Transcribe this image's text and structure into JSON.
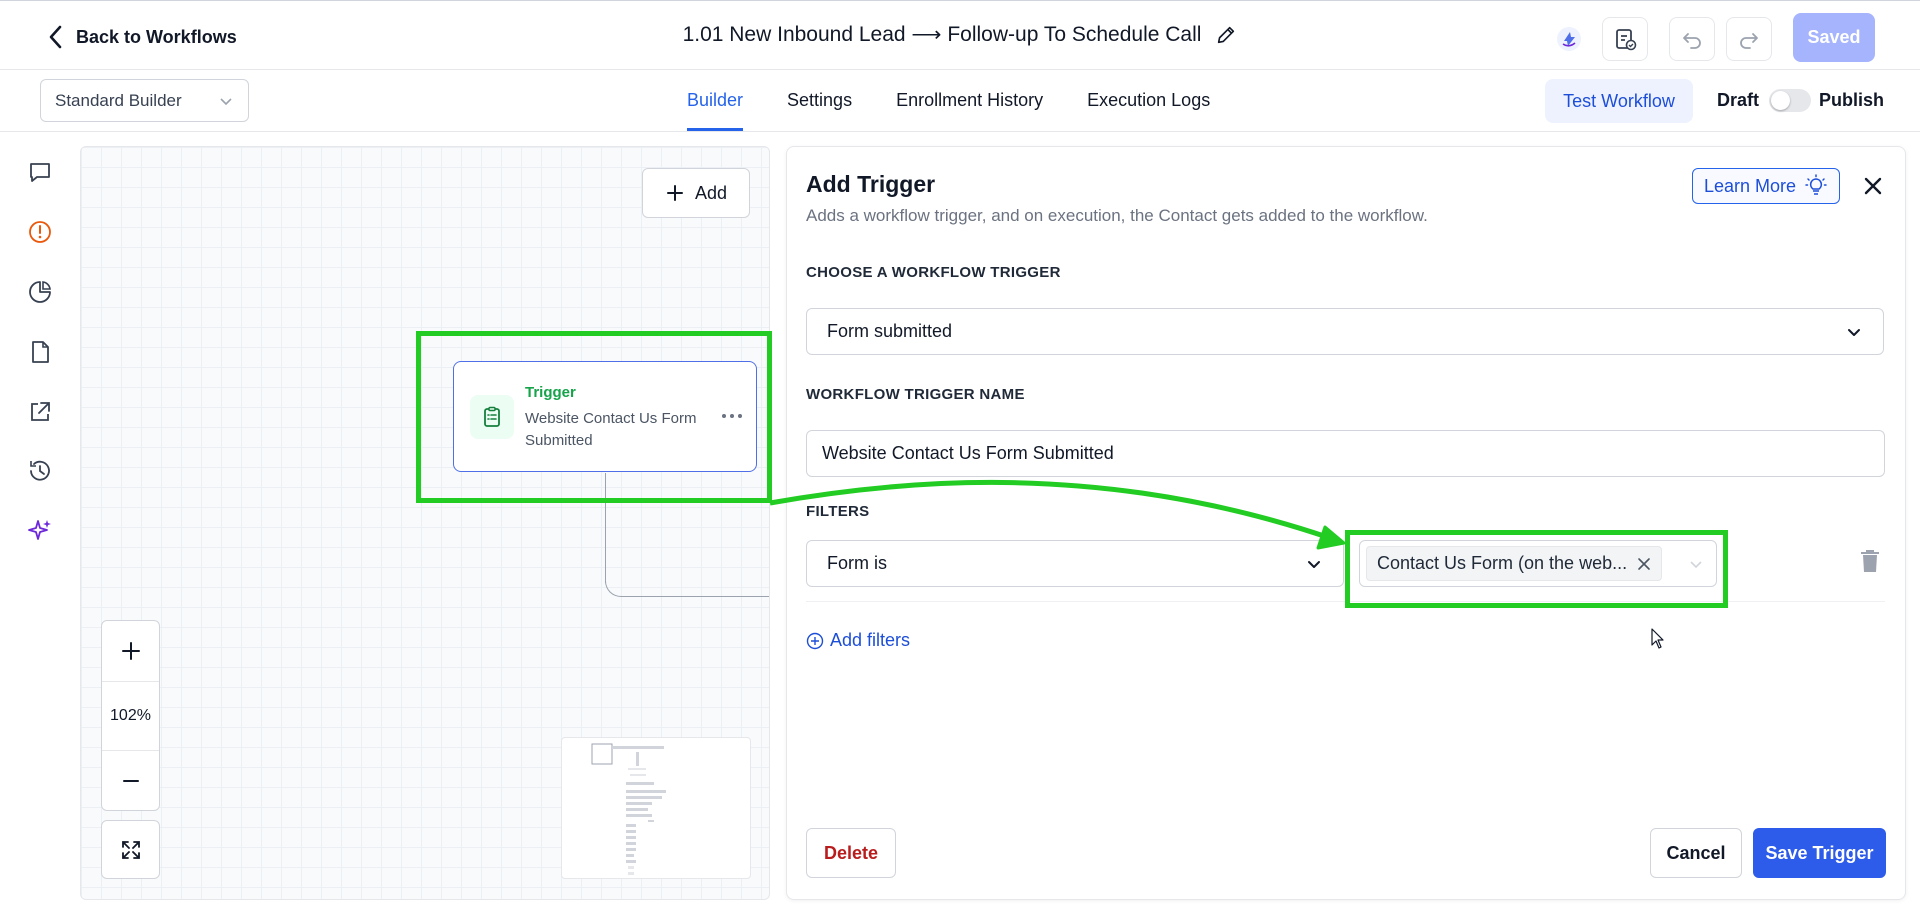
{
  "header": {
    "back_label": "Back to Workflows",
    "workflow_title": "1.01 New Inbound Lead ⟶ Follow-up To Schedule Call",
    "saved_label": "Saved"
  },
  "subheader": {
    "builder_select": "Standard Builder",
    "tabs": [
      {
        "label": "Builder",
        "active": true
      },
      {
        "label": "Settings",
        "active": false
      },
      {
        "label": "Enrollment History",
        "active": false
      },
      {
        "label": "Execution Logs",
        "active": false
      }
    ],
    "test_workflow_label": "Test Workflow",
    "draft_label": "Draft",
    "publish_label": "Publish",
    "published": false
  },
  "left_rail": {
    "icons": [
      "chat-icon",
      "alert-icon",
      "pie-chart-icon",
      "file-icon",
      "external-link-icon",
      "history-icon",
      "sparkles-icon"
    ]
  },
  "canvas": {
    "add_label": "Add",
    "trigger_node": {
      "kicker": "Trigger",
      "title": "Website Contact Us Form Submitted"
    },
    "zoom_level": "102%"
  },
  "panel": {
    "title": "Add Trigger",
    "subtitle": "Adds a workflow trigger, and on execution, the Contact gets added to the workflow.",
    "learn_more_label": "Learn More",
    "choose_trigger_label": "CHOOSE A WORKFLOW TRIGGER",
    "trigger_type": "Form submitted",
    "trigger_name_label": "WORKFLOW TRIGGER NAME",
    "trigger_name_value": "Website Contact Us Form Submitted",
    "filters_label": "FILTERS",
    "filter_field": "Form is",
    "filter_value_chip": "Contact Us Form (on the web...",
    "add_filters_label": "Add filters",
    "delete_label": "Delete",
    "cancel_label": "Cancel",
    "save_label": "Save Trigger"
  },
  "colors": {
    "accent": "#2563eb",
    "annotation": "#22cc22",
    "trigger_green": "#16a34a",
    "danger": "#b91c1c"
  }
}
